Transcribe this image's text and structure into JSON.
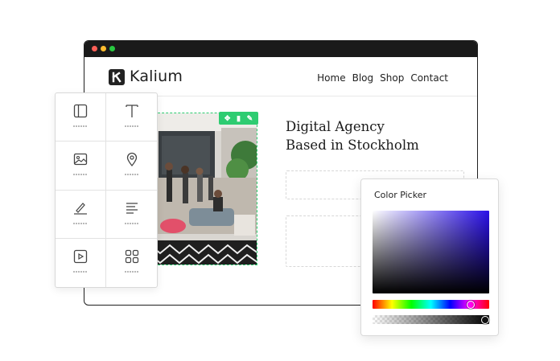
{
  "site": {
    "brand": "Kalium",
    "nav": [
      "Home",
      "Blog",
      "Shop",
      "Contact"
    ],
    "hero_title_line1": "Digital Agency",
    "hero_title_line2": "Based in Stockholm"
  },
  "widgets_panel": {
    "items": [
      {
        "icon": "layout-icon"
      },
      {
        "icon": "text-icon"
      },
      {
        "icon": "image-icon"
      },
      {
        "icon": "map-pin-icon"
      },
      {
        "icon": "signature-icon"
      },
      {
        "icon": "paragraph-icon"
      },
      {
        "icon": "video-icon"
      },
      {
        "icon": "grid-icon"
      }
    ]
  },
  "image_toolbar": {
    "move": "✥",
    "delete": "▮",
    "edit": "✎"
  },
  "color_picker": {
    "title": "Color Picker",
    "hue_position": 0.84,
    "alpha_position": 0.98,
    "accent": "#2a10e8"
  },
  "colors": {
    "selection": "#2ecc71"
  }
}
